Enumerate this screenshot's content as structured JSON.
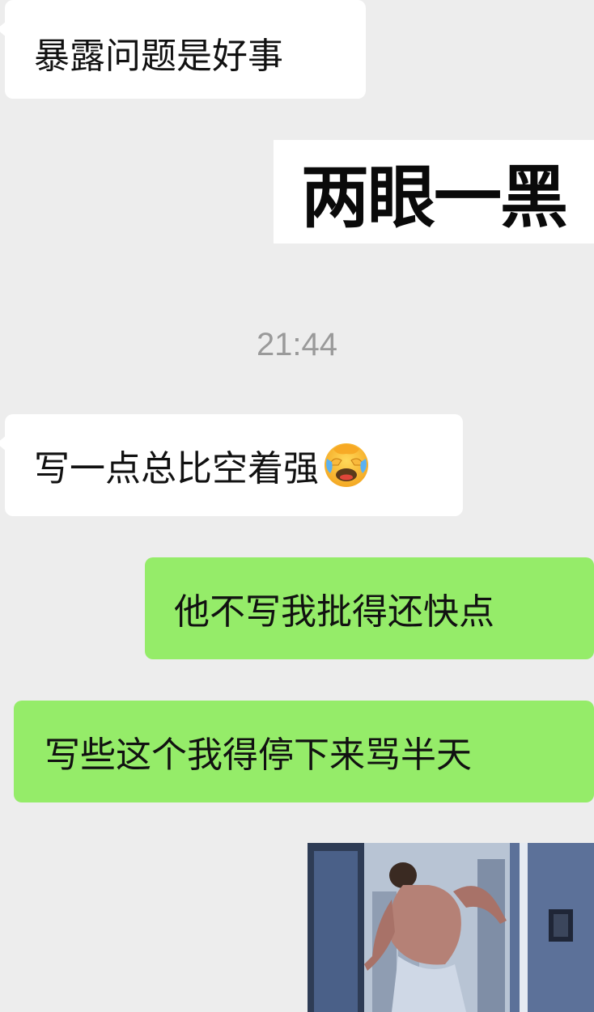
{
  "messages": [
    {
      "id": "m1",
      "direction": "incoming",
      "text": "暴露问题是好事"
    },
    {
      "id": "m2",
      "direction": "outgoing",
      "type": "sticker",
      "text": "两眼一黑"
    },
    {
      "id": "m3",
      "direction": "incoming",
      "text": "写一点总比空着强",
      "emoji": "face-with-tears-of-joy-icon"
    },
    {
      "id": "m4",
      "direction": "outgoing",
      "text": "他不写我批得还快点"
    },
    {
      "id": "m5",
      "direction": "outgoing",
      "text": "写些这个我得停下来骂半天"
    },
    {
      "id": "m6",
      "direction": "outgoing",
      "type": "gif-sticker"
    }
  ],
  "timestamp": "21:44",
  "colors": {
    "background": "#ededed",
    "incoming_bubble": "#ffffff",
    "outgoing_bubble": "#95ec69",
    "timestamp_text": "#9a9a9a"
  }
}
